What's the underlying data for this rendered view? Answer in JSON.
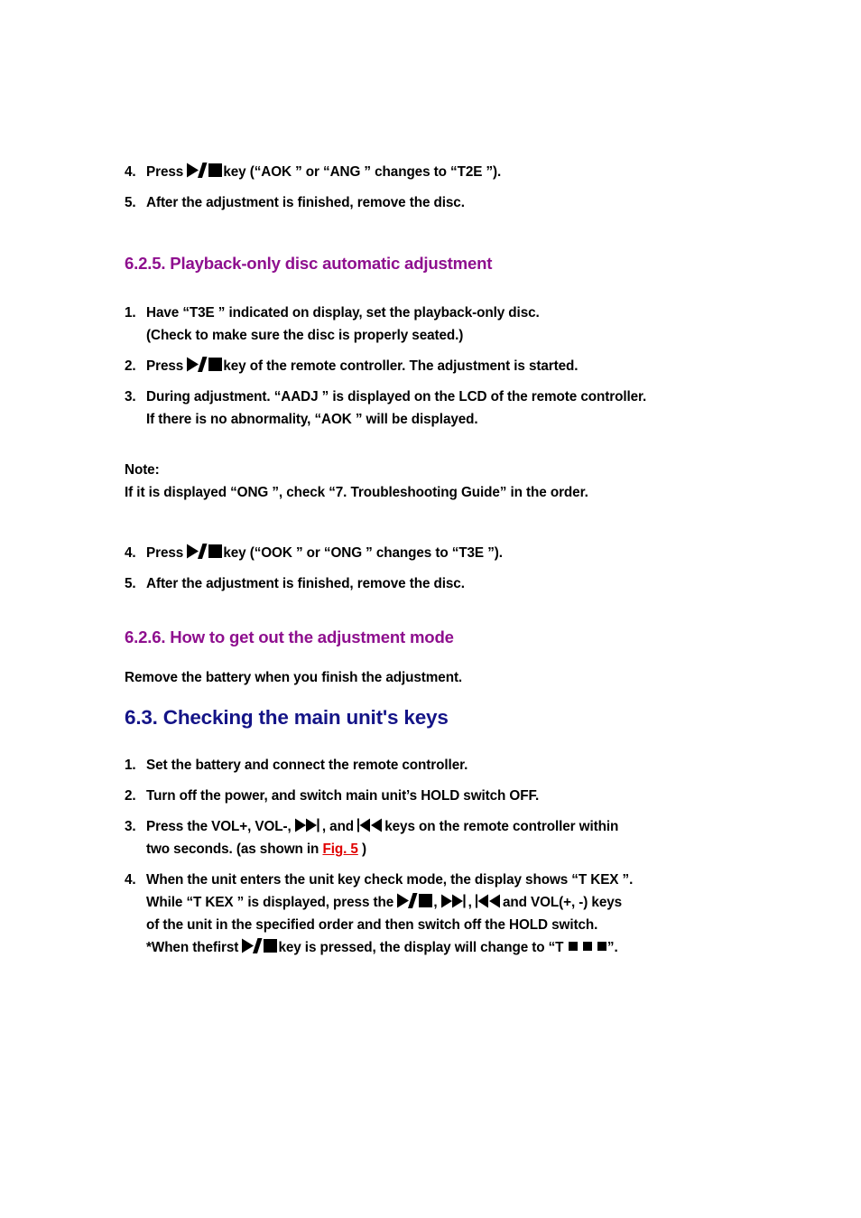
{
  "page": {
    "background": "#ffffff",
    "text_color": "#000000",
    "heading_purple": "#8E0F8E",
    "heading_navy": "#141487",
    "link_red": "#E00000"
  },
  "icons": {
    "play_stop": "play-stop-key-icon",
    "fast_forward": "fast-forward-key-icon",
    "rewind": "rewind-key-icon",
    "square": "display-square-icon"
  },
  "blocks": {
    "item_4_prev": {
      "num": "4.",
      "pre": "Press",
      "post": "key (“AOK ” or “ANG ” changes to “T2E ”)."
    },
    "item_5_prev": {
      "num": "5.",
      "text": "After the adjustment is finished, remove the disc."
    },
    "heading_625": "6.2.5. Playback-only disc automatic adjustment",
    "item_1": {
      "num": "1.",
      "line1": "Have “T3E ” indicated on display, set the playback-only disc.",
      "line2": "(Check to make sure the disc is properly seated.)"
    },
    "item_2": {
      "num": "2.",
      "pre": "Press",
      "post": "key of the remote controller. The adjustment is started."
    },
    "item_3": {
      "num": "3.",
      "line1": "During adjustment. “AADJ ” is displayed on the LCD of the remote controller.",
      "line2": "If there is no abnormality, “AOK ” will be displayed."
    },
    "note": {
      "label": "Note:",
      "text": "If it is displayed “ONG ”, check “7. Troubleshooting Guide” in the order."
    },
    "item_4": {
      "num": "4.",
      "pre": "Press",
      "post": "key (“OOK ” or “ONG ” changes to “T3E ”)."
    },
    "item_5": {
      "num": "5.",
      "text": "After the adjustment is finished, remove the disc."
    },
    "heading_626": "6.2.6. How to get out the adjustment mode",
    "para_626": "Remove the battery when you finish the adjustment.",
    "heading_63": "6.3. Checking the main unit's keys",
    "k_item_1": {
      "num": "1.",
      "text": "Set the battery and connect the remote controller."
    },
    "k_item_2": {
      "num": "2.",
      "text": "Turn off the power, and switch main unit’s HOLD switch OFF."
    },
    "k_item_3": {
      "num": "3.",
      "seg1": "Press the VOL+, VOL-,",
      "seg2": ", and",
      "seg3": "keys on the remote controller within",
      "line2_pre": "two seconds. (as shown in",
      "link": "Fig. 5",
      "line2_post": ")"
    },
    "k_item_4": {
      "num": "4.",
      "line1": "When the unit enters the unit key check mode, the display shows “T KEX ”.",
      "line2_pre": "While “T KEX ” is displayed, press the",
      "line2_mid": ",",
      "line2_mid2": ",",
      "line2_post": "and VOL(+, -) keys",
      "line3": "of the unit in the specified order and then switch off the HOLD switch.",
      "line4_pre": "*When thefirst",
      "line4_mid": "key is pressed, the display will change to “T",
      "line4_post": "”."
    }
  }
}
